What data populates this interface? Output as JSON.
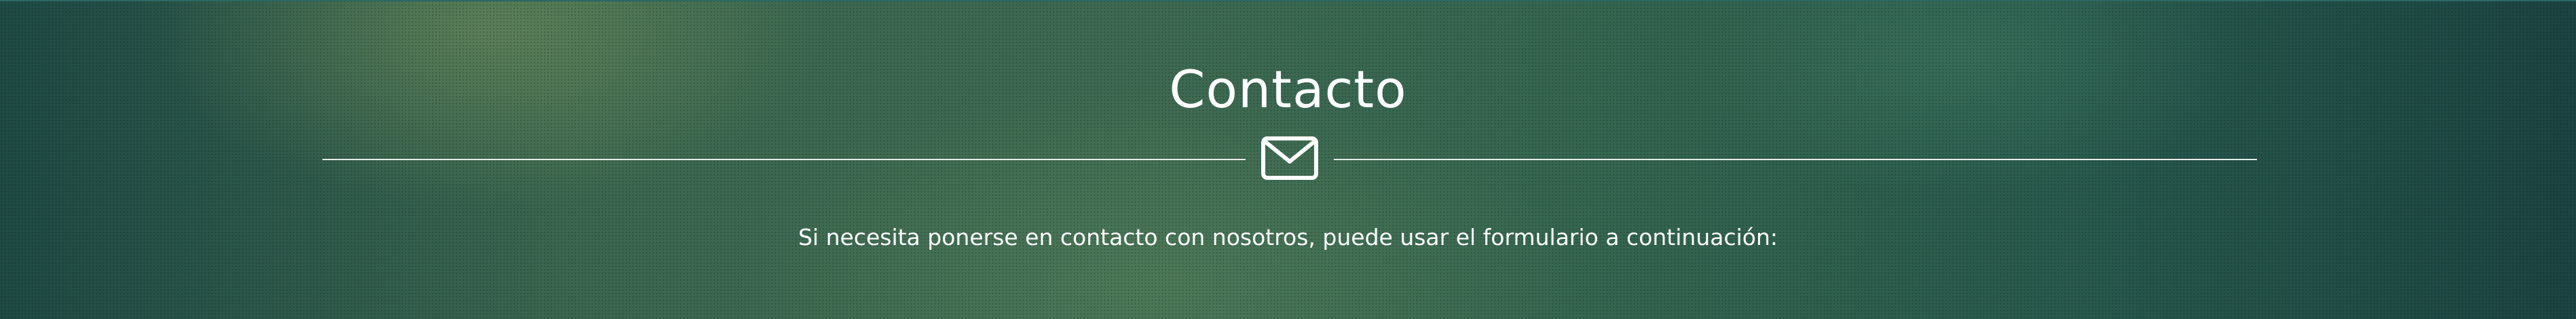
{
  "contact_section": {
    "title": "Contacto",
    "divider_icon": "envelope-icon",
    "intro_text": "Si necesita ponerse en contacto con nosotros, puede usar el formulario a continuación:"
  },
  "colors": {
    "text": "#ffffff",
    "divider": "#e6ece8",
    "background_dark": "#1f4a45",
    "background_mid": "#3e6a52"
  }
}
